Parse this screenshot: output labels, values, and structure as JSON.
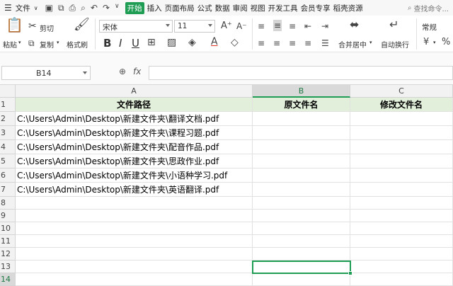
{
  "menubar": {
    "file_label": "文件",
    "tabs": [
      "开始",
      "插入",
      "页面布局",
      "公式",
      "数据",
      "审阅",
      "视图",
      "开发工具",
      "会员专享",
      "稻壳资源"
    ],
    "search_placeholder": "查找命令..."
  },
  "ribbon": {
    "paste_label": "粘贴",
    "cut_label": "剪切",
    "copy_label": "复制",
    "format_painter_label": "格式刷",
    "font_name": "宋体",
    "font_size": "11",
    "merge_label": "合并居中",
    "wrap_label": "自动换行",
    "number_format": "常规"
  },
  "formula_bar": {
    "name_box": "B14",
    "fx_label": "fx",
    "content": ""
  },
  "sheet": {
    "columns": [
      "A",
      "B",
      "C"
    ],
    "header_row": [
      "文件路径",
      "原文件名",
      "修改文件名"
    ],
    "paths": [
      "C:\\Users\\Admin\\Desktop\\新建文件夹\\翻译文档.pdf",
      "C:\\Users\\Admin\\Desktop\\新建文件夹\\课程习题.pdf",
      "C:\\Users\\Admin\\Desktop\\新建文件夹\\配音作品.pdf",
      "C:\\Users\\Admin\\Desktop\\新建文件夹\\思政作业.pdf",
      "C:\\Users\\Admin\\Desktop\\新建文件夹\\小语种学习.pdf",
      "C:\\Users\\Admin\\Desktop\\新建文件夹\\英语翻译.pdf"
    ],
    "row_numbers": [
      "1",
      "2",
      "3",
      "4",
      "5",
      "6",
      "7",
      "8",
      "9",
      "10",
      "11",
      "12",
      "13",
      "14"
    ],
    "selected_cell": "B14"
  },
  "colors": {
    "accent": "#1f9d55",
    "header_fill": "#e2efda"
  }
}
